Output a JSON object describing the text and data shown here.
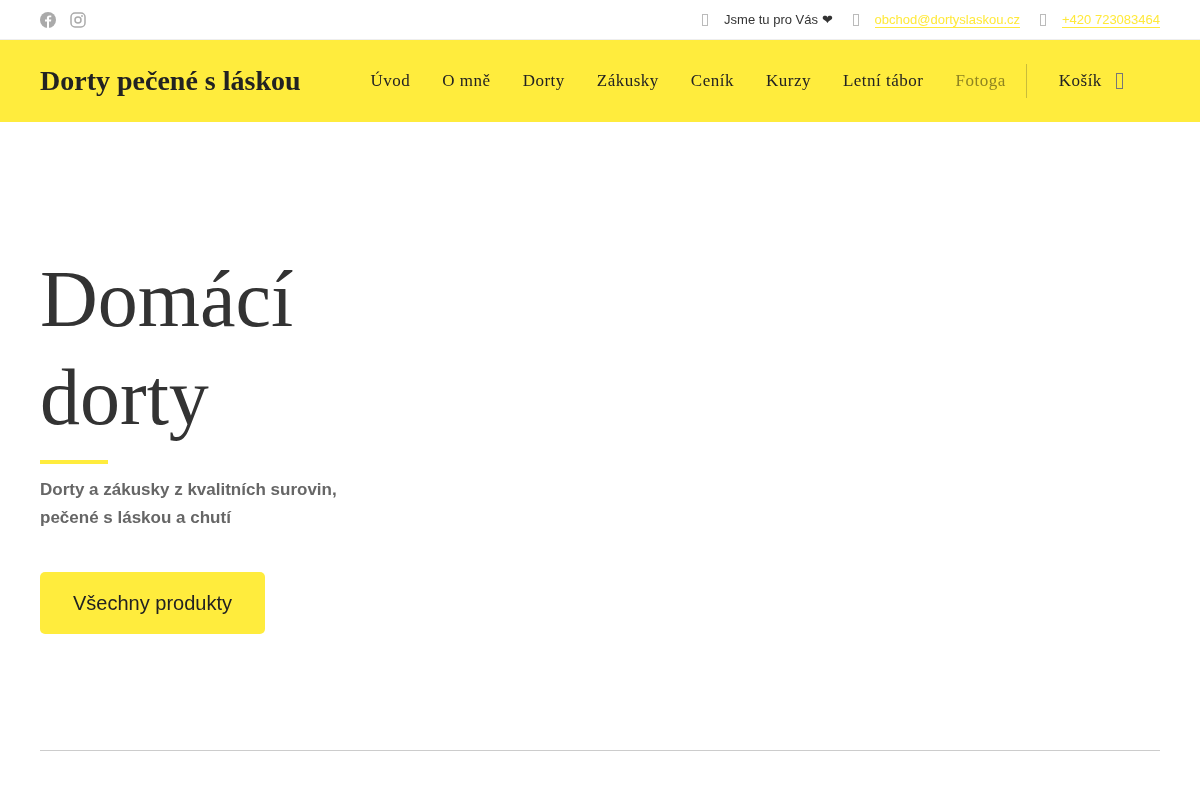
{
  "topbar": {
    "contacts": [
      {
        "kind": "text",
        "text": "Jsme tu pro Vás ❤"
      },
      {
        "kind": "link",
        "text": "obchod@dortyslaskou.cz"
      },
      {
        "kind": "link",
        "text": "+420 723083464"
      }
    ]
  },
  "header": {
    "logo": "Dorty pečené s láskou",
    "nav": [
      {
        "label": "Úvod",
        "faded": false
      },
      {
        "label": "O mně",
        "faded": false
      },
      {
        "label": "Dorty",
        "faded": false
      },
      {
        "label": "Zákusky",
        "faded": false
      },
      {
        "label": "Ceník",
        "faded": false
      },
      {
        "label": "Kurzy",
        "faded": false
      },
      {
        "label": "Letní tábor",
        "faded": false
      },
      {
        "label": "Fotoga",
        "faded": true
      }
    ],
    "cart": "Košík"
  },
  "hero": {
    "title_lines": [
      "Domácí",
      "dorty"
    ],
    "subtitle_lines": [
      "Dorty a zákusky z kvalitních surovin,",
      "pečené s láskou a chutí"
    ],
    "button": "Všechny produkty"
  }
}
